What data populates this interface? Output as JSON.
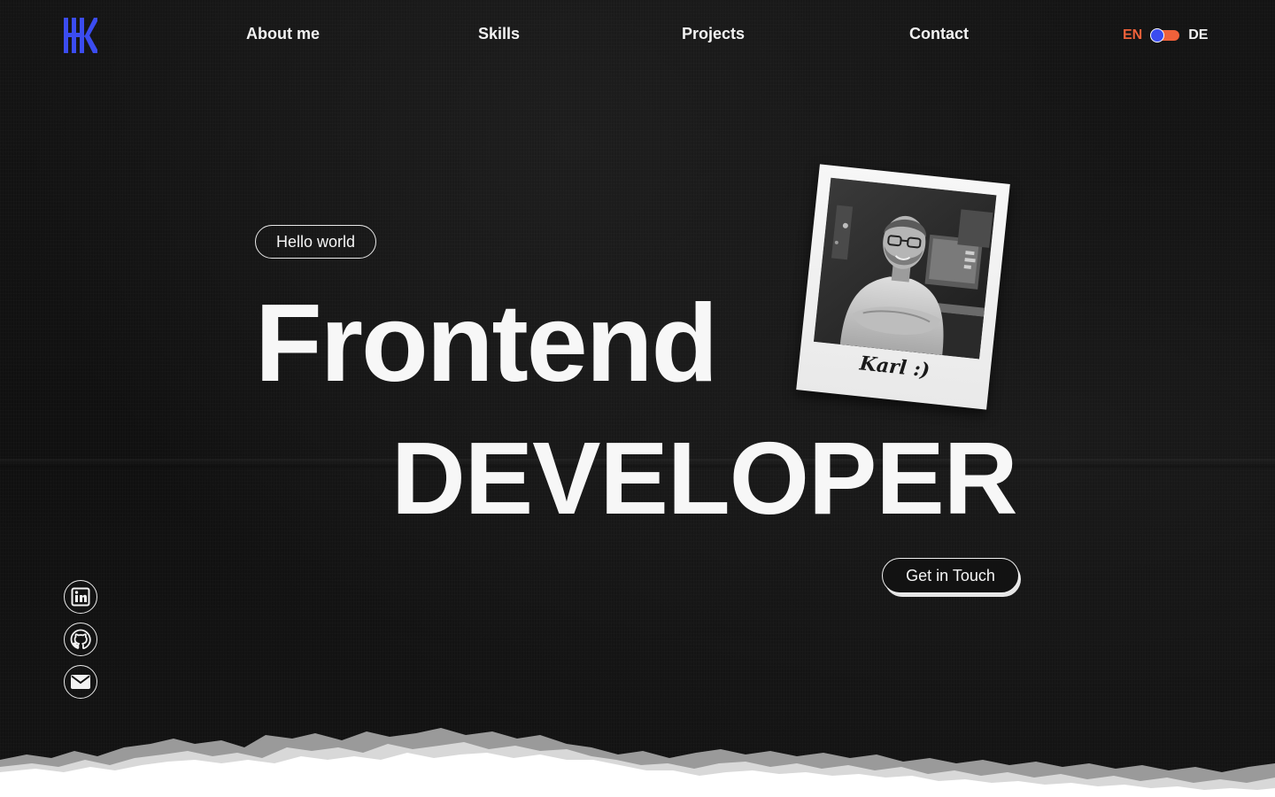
{
  "nav": {
    "items": [
      {
        "label": "About me"
      },
      {
        "label": "Skills"
      },
      {
        "label": "Projects"
      },
      {
        "label": "Contact"
      }
    ]
  },
  "language": {
    "options": [
      "EN",
      "DE"
    ],
    "selected": "EN"
  },
  "hero": {
    "greeting_pill": "Hello world",
    "headline_line1": "Frontend",
    "headline_line2": "DEVELOPER",
    "cta_label": "Get in Touch"
  },
  "polaroid": {
    "caption": "Karl :)"
  },
  "social": [
    {
      "icon": "linkedin-icon"
    },
    {
      "icon": "github-icon"
    },
    {
      "icon": "mail-icon"
    }
  ],
  "colors": {
    "background": "#121212",
    "text": "#f5f5f5",
    "logo_accent": "#3b4cf0",
    "language_accent": "#f0613a",
    "paper": "#ffffff"
  }
}
